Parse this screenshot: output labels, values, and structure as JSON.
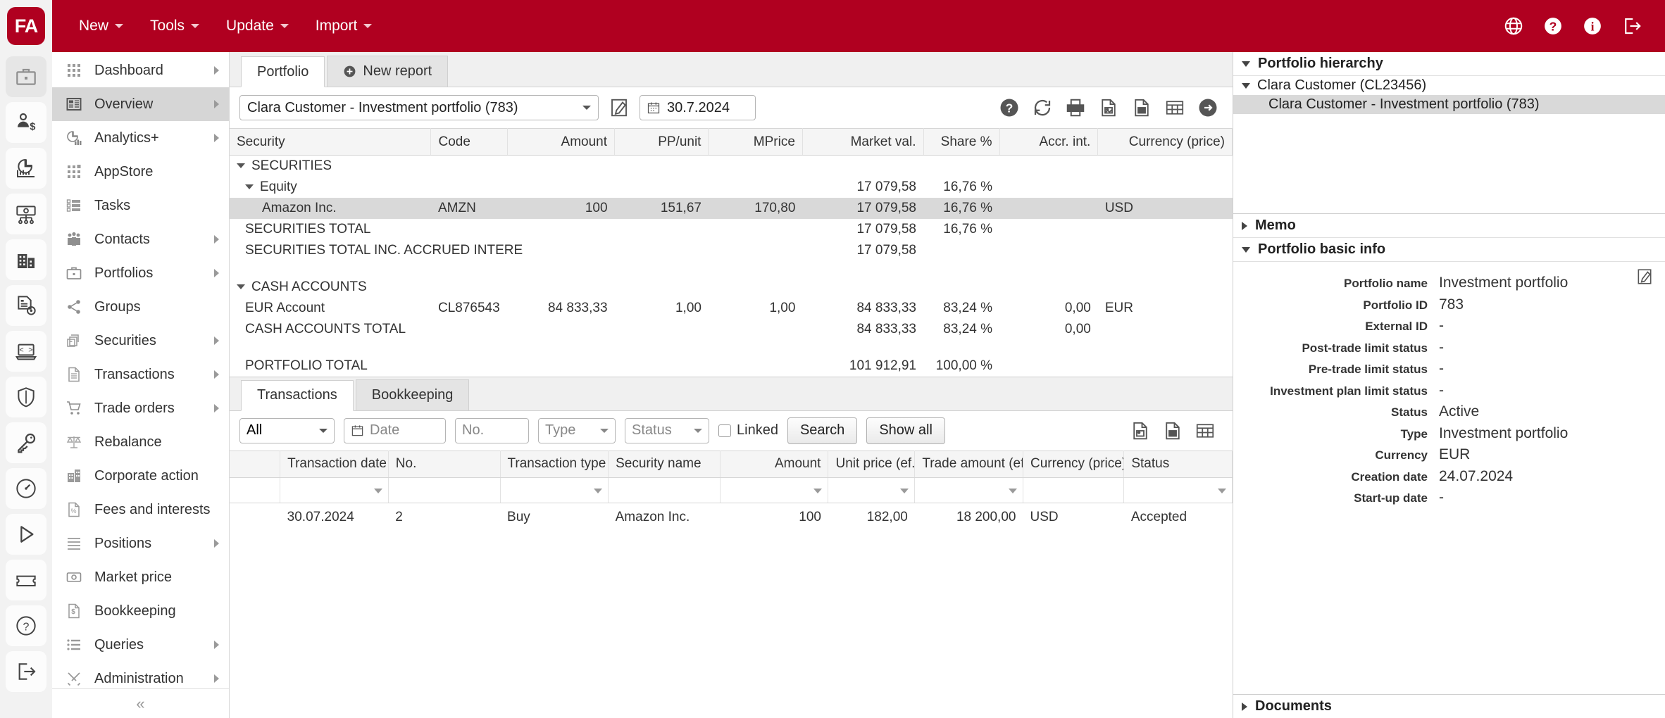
{
  "app": {
    "logo_text": "FA",
    "topnav": [
      {
        "label": "New",
        "icon": "chevron-down-icon"
      },
      {
        "label": "Tools",
        "icon": "chevron-down-icon"
      },
      {
        "label": "Update",
        "icon": "chevron-down-icon"
      },
      {
        "label": "Import",
        "icon": "chevron-down-icon"
      }
    ],
    "topright_icons": [
      "globe-icon",
      "help-circle-icon",
      "info-circle-icon",
      "logout-icon"
    ],
    "brand_color": "#b00020"
  },
  "rail": {
    "items": [
      {
        "name": "briefcase-icon",
        "active": true
      },
      {
        "name": "client-money-icon",
        "active": false
      },
      {
        "name": "analytics-chart-icon",
        "active": false
      },
      {
        "name": "cash-flow-icon",
        "active": false
      },
      {
        "name": "building-icon",
        "active": false
      },
      {
        "name": "report-settings-icon",
        "active": false
      },
      {
        "name": "code-laptop-icon",
        "active": false
      },
      {
        "name": "shield-icon",
        "active": false
      },
      {
        "name": "key-icon",
        "active": false
      },
      {
        "name": "speedometer-icon",
        "active": false
      },
      {
        "name": "play-icon",
        "active": false
      },
      {
        "name": "ticket-icon",
        "active": false
      },
      {
        "name": "help-circle-icon",
        "active": false
      },
      {
        "name": "logout-icon",
        "active": false
      }
    ]
  },
  "sidebar": {
    "collapse_label": "«",
    "items": [
      {
        "label": "Dashboard",
        "icon": "grid-dots-icon",
        "arrow": true,
        "active": false
      },
      {
        "label": "Overview",
        "icon": "overview-page-icon",
        "arrow": true,
        "active": true
      },
      {
        "label": "Analytics+",
        "icon": "pie-bar-icon",
        "arrow": true,
        "active": false
      },
      {
        "label": "AppStore",
        "icon": "appstore-grid-icon",
        "arrow": false,
        "active": false
      },
      {
        "label": "Tasks",
        "icon": "tasks-list-icon",
        "arrow": false,
        "active": false
      },
      {
        "label": "Contacts",
        "icon": "people-icon",
        "arrow": true,
        "active": false
      },
      {
        "label": "Portfolios",
        "icon": "briefcase-icon",
        "arrow": true,
        "active": false
      },
      {
        "label": "Groups",
        "icon": "share-nodes-icon",
        "arrow": false,
        "active": false
      },
      {
        "label": "Securities",
        "icon": "boxes-icon",
        "arrow": true,
        "active": false
      },
      {
        "label": "Transactions",
        "icon": "document-lines-icon",
        "arrow": true,
        "active": false
      },
      {
        "label": "Trade orders",
        "icon": "shopping-cart-icon",
        "arrow": true,
        "active": false
      },
      {
        "label": "Rebalance",
        "icon": "scales-icon",
        "arrow": false,
        "active": false
      },
      {
        "label": "Corporate action",
        "icon": "corporate-building-icon",
        "arrow": false,
        "active": false
      },
      {
        "label": "Fees and interests",
        "icon": "fees-doc-icon",
        "arrow": false,
        "active": false
      },
      {
        "label": "Positions",
        "icon": "positions-list-icon",
        "arrow": true,
        "active": false
      },
      {
        "label": "Market price",
        "icon": "price-tag-icon",
        "arrow": false,
        "active": false
      },
      {
        "label": "Bookkeeping",
        "icon": "bookkeeping-doc-icon",
        "arrow": false,
        "active": false
      },
      {
        "label": "Queries",
        "icon": "bullet-list-icon",
        "arrow": true,
        "active": false
      },
      {
        "label": "Administration",
        "icon": "tools-cross-icon",
        "arrow": true,
        "active": false
      }
    ]
  },
  "main": {
    "tabs": [
      {
        "label": "Portfolio",
        "icon": null,
        "active": true
      },
      {
        "label": "New report",
        "icon": "plus-circle-icon",
        "active": false
      }
    ],
    "portfolio_select": {
      "value": "Clara Customer - Investment portfolio (783)",
      "icon": "chevron-down-icon"
    },
    "edit_icon": "edit-pencil-icon",
    "date_field": {
      "value": "30.7.2024",
      "icon": "calendar-icon"
    },
    "toolbar_icons": [
      "help-circle-icon",
      "refresh-icon",
      "print-icon",
      "export-image-icon",
      "export-excel-icon",
      "table-view-icon",
      "arrow-right-circle-icon"
    ]
  },
  "portfolio_table": {
    "columns": [
      {
        "label": "Security",
        "align": "left"
      },
      {
        "label": "Code",
        "align": "left"
      },
      {
        "label": "Amount",
        "align": "right"
      },
      {
        "label": "PP/unit",
        "align": "right"
      },
      {
        "label": "MPrice",
        "align": "right"
      },
      {
        "label": "Market val.",
        "align": "right"
      },
      {
        "label": "Share %",
        "align": "right"
      },
      {
        "label": "Accr. int.",
        "align": "right"
      },
      {
        "label": "Currency (price)",
        "align": "right"
      }
    ],
    "rows": [
      {
        "type": "group",
        "indent": 0,
        "twisty": true,
        "security": "SECURITIES",
        "code": "",
        "amount": "",
        "pp_unit": "",
        "mprice": "",
        "market_val": "",
        "share": "",
        "accr_int": "",
        "currency": "",
        "selected": false
      },
      {
        "type": "group",
        "indent": 1,
        "twisty": true,
        "security": "Equity",
        "code": "",
        "amount": "",
        "pp_unit": "",
        "mprice": "",
        "market_val": "17 079,58",
        "share": "16,76 %",
        "accr_int": "",
        "currency": "",
        "selected": false
      },
      {
        "type": "item",
        "indent": 2,
        "twisty": false,
        "security": "Amazon Inc.",
        "code": "AMZN",
        "amount": "100",
        "pp_unit": "151,67",
        "mprice": "170,80",
        "market_val": "17 079,58",
        "share": "16,76 %",
        "accr_int": "",
        "currency": "USD",
        "selected": true
      },
      {
        "type": "total",
        "indent": 1,
        "twisty": false,
        "security": "SECURITIES TOTAL",
        "code": "",
        "amount": "",
        "pp_unit": "",
        "mprice": "",
        "market_val": "17 079,58",
        "share": "16,76 %",
        "accr_int": "",
        "currency": "",
        "selected": false
      },
      {
        "type": "total",
        "indent": 1,
        "twisty": false,
        "security": "SECURITIES TOTAL INC. ACCRUED INTERE",
        "code": "",
        "amount": "",
        "pp_unit": "",
        "mprice": "",
        "market_val": "17 079,58",
        "share": "",
        "accr_int": "",
        "currency": "",
        "selected": false
      },
      {
        "type": "spacer"
      },
      {
        "type": "group",
        "indent": 0,
        "twisty": true,
        "security": "CASH ACCOUNTS",
        "code": "",
        "amount": "",
        "pp_unit": "",
        "mprice": "",
        "market_val": "",
        "share": "",
        "accr_int": "",
        "currency": "",
        "selected": false
      },
      {
        "type": "item",
        "indent": 1,
        "twisty": false,
        "security": "EUR Account",
        "code": "CL876543",
        "amount": "84 833,33",
        "pp_unit": "1,00",
        "mprice": "1,00",
        "market_val": "84 833,33",
        "share": "83,24 %",
        "accr_int": "0,00",
        "currency": "EUR",
        "selected": false
      },
      {
        "type": "total",
        "indent": 1,
        "twisty": false,
        "security": "CASH ACCOUNTS TOTAL",
        "code": "",
        "amount": "",
        "pp_unit": "",
        "mprice": "",
        "market_val": "84 833,33",
        "share": "83,24 %",
        "accr_int": "0,00",
        "currency": "",
        "selected": false
      },
      {
        "type": "spacer"
      },
      {
        "type": "total",
        "indent": 1,
        "twisty": false,
        "security": "PORTFOLIO TOTAL",
        "code": "",
        "amount": "",
        "pp_unit": "",
        "mprice": "",
        "market_val": "101 912,91",
        "share": "100,00 %",
        "accr_int": "",
        "currency": "",
        "selected": false
      }
    ]
  },
  "bottom": {
    "tabs": [
      {
        "label": "Transactions",
        "active": true
      },
      {
        "label": "Bookkeeping",
        "active": false
      }
    ],
    "filters": {
      "scope_select": {
        "value": "All",
        "icon": "chevron-down-icon"
      },
      "date_input": {
        "placeholder": "Date",
        "value": "",
        "icon": "calendar-icon"
      },
      "no_input": {
        "placeholder": "No.",
        "value": ""
      },
      "type_select": {
        "value": "Type",
        "icon": "chevron-down-icon"
      },
      "status_select": {
        "value": "Status",
        "icon": "chevron-down-icon"
      },
      "linked_checkbox": {
        "label": "Linked",
        "checked": false
      },
      "search_button": "Search",
      "show_all_button": "Show all",
      "tool_icons": [
        "export-image-icon",
        "export-excel-icon",
        "table-view-icon"
      ]
    },
    "table": {
      "columns": [
        {
          "label": "",
          "align": "left",
          "filter": false
        },
        {
          "label": "Transaction date (…",
          "align": "left",
          "filter": true
        },
        {
          "label": "No.",
          "align": "left",
          "filter": false
        },
        {
          "label": "Transaction type",
          "align": "left",
          "filter": true
        },
        {
          "label": "Security name",
          "align": "left",
          "filter": false
        },
        {
          "label": "Amount",
          "align": "right",
          "filter": true
        },
        {
          "label": "Unit price (ef.)",
          "align": "right",
          "filter": true
        },
        {
          "label": "Trade amount (ef.)",
          "align": "right",
          "filter": true
        },
        {
          "label": "Currency (price)",
          "align": "left",
          "filter": false
        },
        {
          "label": "Status",
          "align": "left",
          "filter": true
        }
      ],
      "rows": [
        {
          "blank": "",
          "transaction_date": "30.07.2024",
          "no": "2",
          "transaction_type": "Buy",
          "security_name": "Amazon Inc.",
          "amount": "100",
          "unit_price": "182,00",
          "trade_amount": "18 200,00",
          "currency": "USD",
          "status": "Accepted"
        }
      ]
    }
  },
  "right_panel": {
    "hierarchy": {
      "title": "Portfolio hierarchy",
      "expanded": true,
      "nodes": [
        {
          "label": "Clara Customer (CL23456)",
          "level": 1,
          "twisty": true,
          "selected": false
        },
        {
          "label": "Clara Customer - Investment portfolio (783)",
          "level": 2,
          "twisty": false,
          "selected": true
        }
      ]
    },
    "memo": {
      "title": "Memo",
      "expanded": false
    },
    "basic_info": {
      "title": "Portfolio basic info",
      "expanded": true,
      "edit_icon": "edit-pencil-icon",
      "fields": [
        {
          "label": "Portfolio name",
          "value": "Investment portfolio"
        },
        {
          "label": "Portfolio ID",
          "value": "783"
        },
        {
          "label": "External ID",
          "value": "-"
        },
        {
          "label": "Post-trade limit status",
          "value": "-"
        },
        {
          "label": "Pre-trade limit status",
          "value": "-"
        },
        {
          "label": "Investment plan limit status",
          "value": "-"
        },
        {
          "label": "Status",
          "value": "Active"
        },
        {
          "label": "Type",
          "value": "Investment portfolio"
        },
        {
          "label": "Currency",
          "value": "EUR"
        },
        {
          "label": "Creation date",
          "value": "24.07.2024"
        },
        {
          "label": "Start-up date",
          "value": "-"
        }
      ]
    },
    "documents": {
      "title": "Documents",
      "expanded": false
    }
  }
}
